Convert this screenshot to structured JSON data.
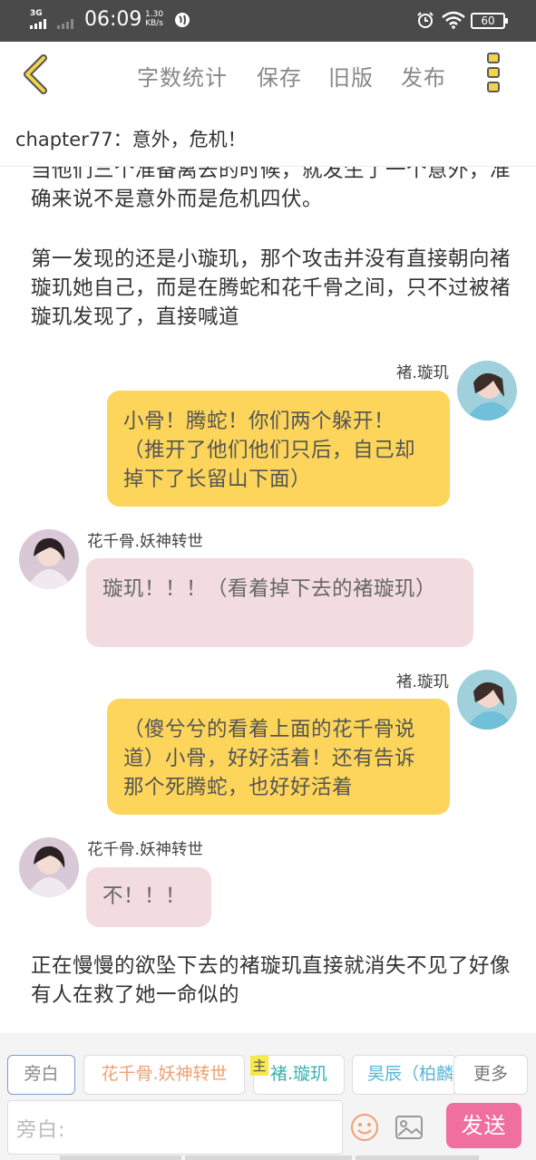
{
  "status_bar": {
    "network": "3G",
    "time": "06:09",
    "speed_value": "1.30",
    "speed_unit": "KB/s",
    "battery": "60"
  },
  "toolbar": {
    "word_count": "字数统计",
    "save": "保存",
    "old_version": "旧版",
    "publish": "发布",
    "icons": [
      "chevron-left-icon",
      "more-vertical-icon"
    ]
  },
  "chapter": {
    "title": "chapter77：意外，危机！"
  },
  "story": {
    "narration_1": "当他们三个准备离去的时候，就发生了一个意外，准确来说不是意外而是危机四伏。",
    "narration_2": "第一发现的还是小璇玑，那个攻击并没有直接朝向褚璇玑她自己，而是在腾蛇和花千骨之间，只不过被褚璇玑发现了，直接喊道",
    "messages": [
      {
        "speaker": "褚.璇玑",
        "side": "right",
        "text": "小骨！腾蛇！你们两个躲开！（推开了他们他们只后，自己却掉下了长留山下面）"
      },
      {
        "speaker": "花千骨.妖神转世",
        "side": "left",
        "text": "璇玑！！！（看着掉下去的褚璇玑）"
      },
      {
        "speaker": "褚.璇玑",
        "side": "right",
        "text": "（傻兮兮的看着上面的花千骨说道）小骨，好好活着！还有告诉那个死腾蛇，也好好活着"
      },
      {
        "speaker": "花千骨.妖神转世",
        "side": "left",
        "text": "不！！！"
      }
    ],
    "narration_3": "正在慢慢的欲坠下去的褚璇玑直接就消失不见了好像有人在救了她一命似的"
  },
  "composer": {
    "roles": [
      "旁白",
      "花千骨.妖神转世",
      "褚.璇玑",
      "昊辰（柏麟"
    ],
    "main_tag": "主",
    "more": "更多",
    "input_placeholder": "旁白:",
    "send": "发送",
    "icons": [
      "emoji-icon",
      "image-icon"
    ]
  },
  "colors": {
    "status_bar": "#4a4a4a",
    "yellow_bubble": "#fcd55a",
    "pink_bubble": "#f2dcdf",
    "send_button": "#ef6f9e",
    "back_arrow": "#f2d34a"
  }
}
